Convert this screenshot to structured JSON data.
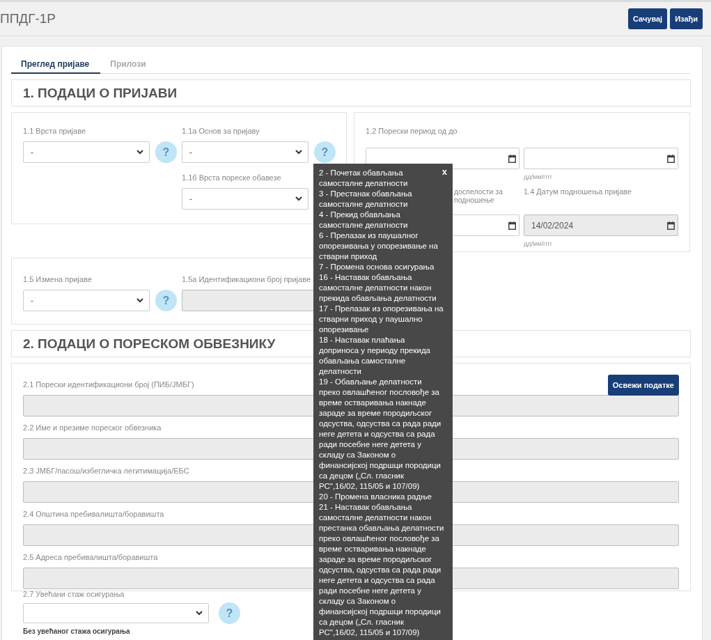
{
  "header": {
    "title": "ППДГ-1Р",
    "buttons": [
      "Сачувај",
      "Изађи"
    ]
  },
  "tabs": [
    {
      "label": "Преглед пријаве",
      "selected": true
    },
    {
      "label": "Прилози",
      "selected": false
    }
  ],
  "section_1": {
    "title": "1. ПОДАЦИ О ПРИЈАВИ",
    "left_panel": {
      "columns": [
        [
          {
            "label": "1.1 Врста пријаве",
            "value": "-",
            "help": "?"
          }
        ],
        [
          {
            "label": "1.1а Основ за пријаву",
            "value": "-",
            "help": "?"
          },
          {
            "label": "1.1б Врста пореске обавезе",
            "value": "-"
          }
        ]
      ]
    },
    "right_panel": {
      "cells": [
        {
          "label": "1.2 Порески период од до",
          "disabled": false
        },
        {
          "hint": "дд/мм/гггг",
          "disabled": false
        },
        {
          "label": "доспелости за подношење",
          "disabled": false
        },
        {
          "label": "1.4 Датум подношења пријаве",
          "value": "14/02/2024",
          "hint": "дд/мм/гггг",
          "disabled": true
        }
      ]
    },
    "change_panel": {
      "select": {
        "label": "1.5 Измена пријаве",
        "value": "-",
        "help": "?"
      },
      "input": {
        "label": "1.5а Идентификациони број пријаве",
        "disabled": true
      }
    }
  },
  "section_2": {
    "title": "2. ПОДАЦИ О ПОРЕСКОМ ОБВЕЗНИКУ",
    "refresh_button": "Освежи податке",
    "fields": [
      {
        "label": "2.1 Порески идентификациони број (ПИБ/ЈМБГ)",
        "disabled": true
      },
      {
        "label": "2.2 Име и презиме пореског обвезника",
        "disabled": true
      },
      {
        "label": "2.3 ЈМБГ/пасош/избегличка легитимација/ЕБС",
        "disabled": true
      },
      {
        "label": "2.4 Општина пребивалишта/боравишта",
        "disabled": true
      },
      {
        "label": "2.5 Адреса пребивалишта/боравишта",
        "disabled": true
      }
    ],
    "insurance": {
      "label": "2.7 Увећани стаж осигурања",
      "help": "?",
      "note": "Без увећаног стажа осигурања"
    }
  },
  "tooltip": {
    "close": "x",
    "items": [
      "2 - Почетак обављања самосталне делатности",
      "3 - Престанак обављања самосталне делатности",
      "4 - Прекид обављања самосталне делатности",
      "6 - Прелазак из паушалног опорезивања у опорезивање на стварни приход",
      "7 - Промена основа осигурања",
      "16 - Наставак обављања самосталне делатности након прекида обављања делатности",
      "17 - Прелазак из опорезивања на стварни приход у паушално опорезивање",
      "18 - Наставак плаћања доприноса у периоду прекида обављања самосталне делатности",
      "19 - Обављање делатности преко овлашћеног пословође за време остваривања накнаде зараде за време породиљског одсуства, одсуства са рада ради неге детета и одсуства са рада ради посебне неге детета у складу са Законом о финансијској подршци породици са децом („Сл. гласник РС\",16/02, 115/05 и 107/09)",
      "20 - Промена власника радње",
      "21 - Наставак обављања самосталне делатности након престанка обављања делатности преко овлашћеног пословође за време остваривања накнаде зараде за време породиљског одсуства, одсуства са рада ради неге детета и одсуства са рада ради посебне неге детета у складу са Законом о финансијској подршци породици са децом („Сл. гласник РС\",16/02, 115/05 и 107/09)"
    ]
  }
}
